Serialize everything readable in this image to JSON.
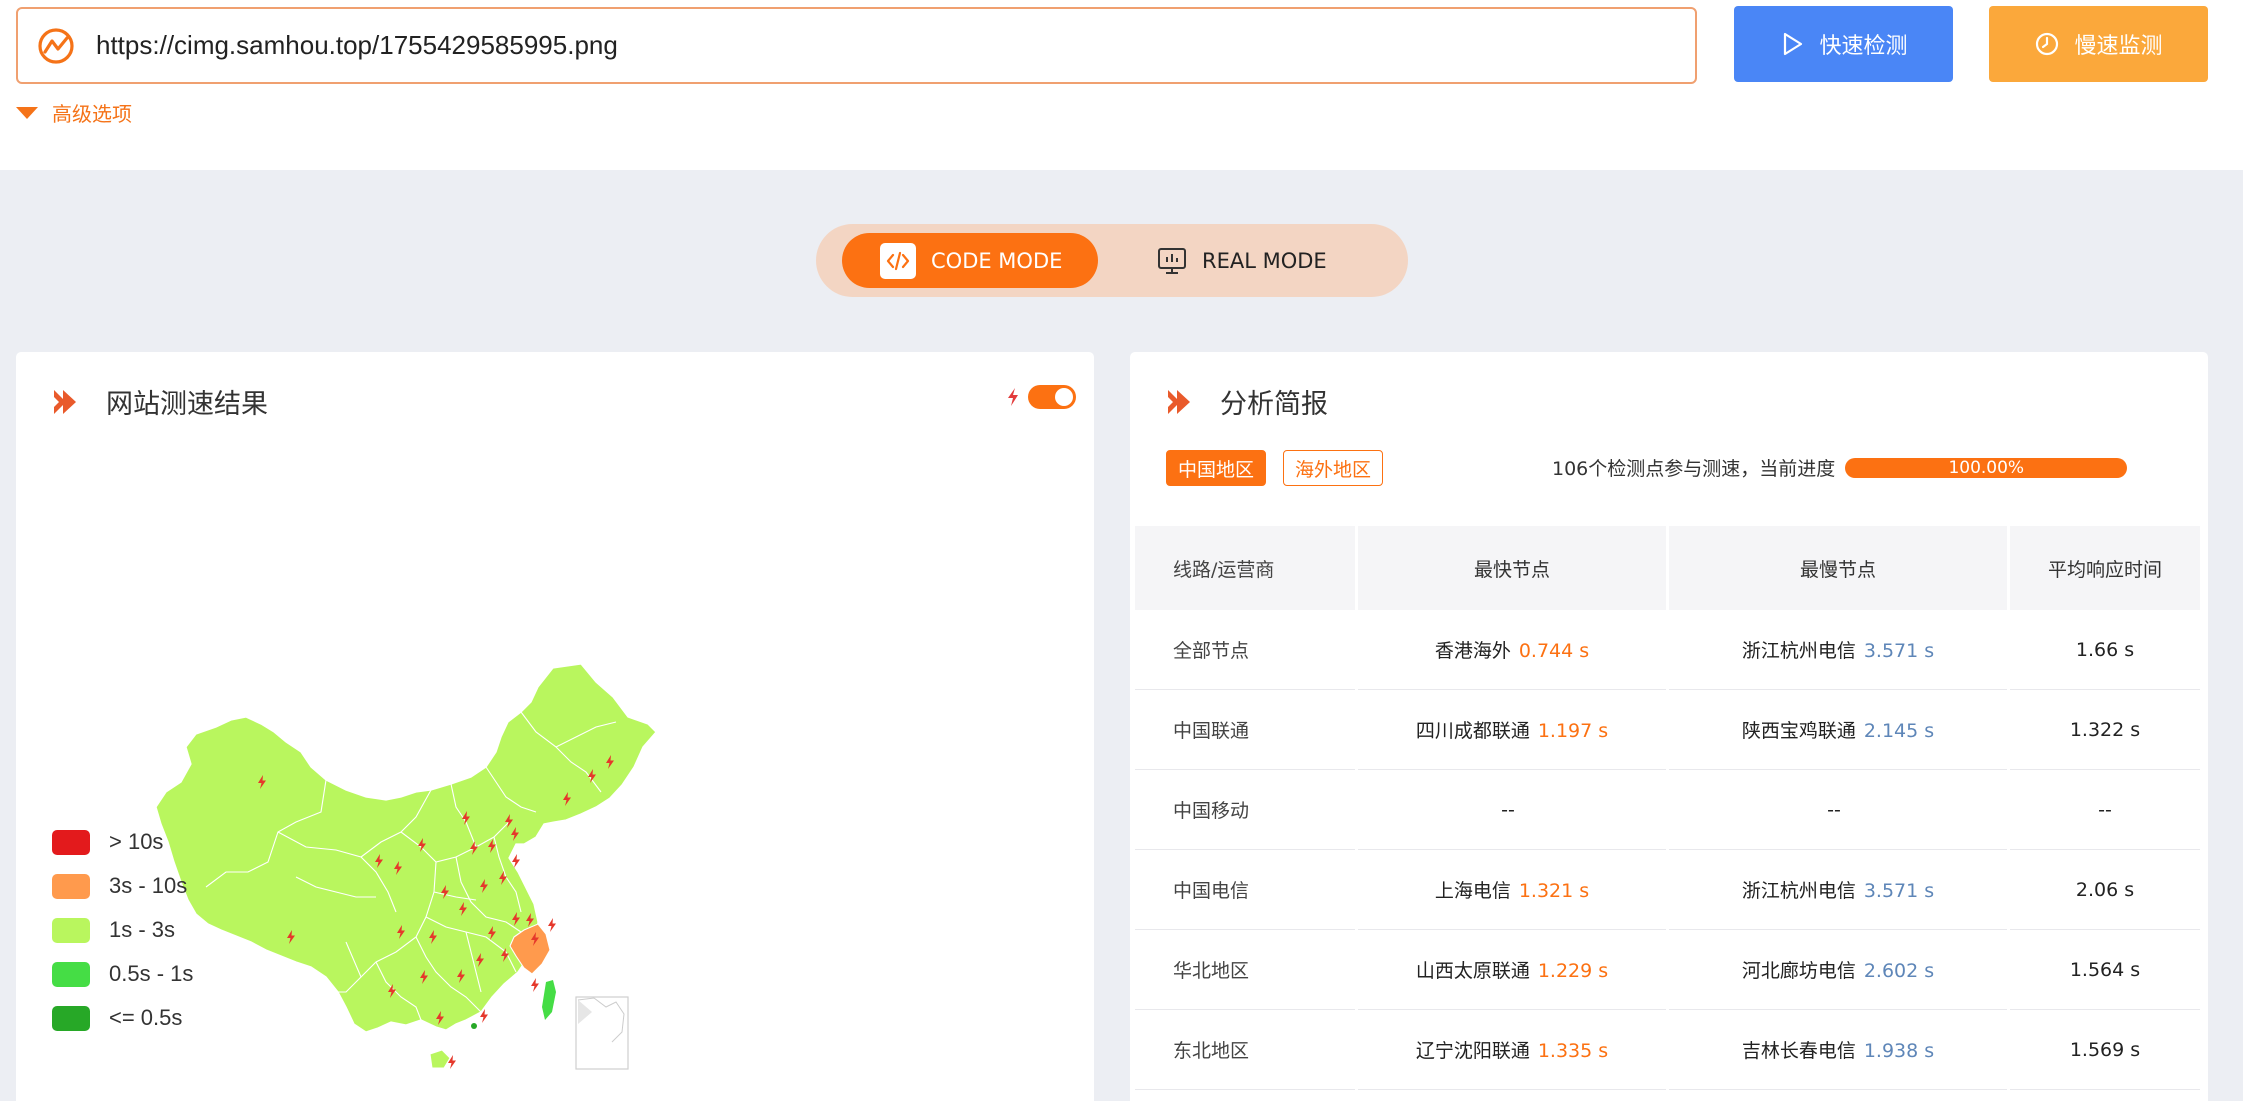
{
  "url_input": {
    "value": "https://cimg.samhou.top/1755429585995.png"
  },
  "buttons": {
    "fast": "快速检测",
    "slow": "慢速监测"
  },
  "advanced": "高级选项",
  "modes": {
    "code": "CODE MODE",
    "real": "REAL MODE",
    "active": "code"
  },
  "left_panel": {
    "title": "网站测速结果",
    "legend": [
      {
        "label": "> 10s",
        "color": "#e31a1c"
      },
      {
        "label": "3s - 10s",
        "color": "#ff9a4d"
      },
      {
        "label": "1s - 3s",
        "color": "#b9f65e"
      },
      {
        "label": "0.5s - 1s",
        "color": "#45dd45"
      },
      {
        "label": "<= 0.5s",
        "color": "#27a827"
      }
    ]
  },
  "right_panel": {
    "title": "分析简报",
    "tabs": [
      "中国地区",
      "海外地区"
    ],
    "progress_text": "106个检测点参与测速，当前进度",
    "progress_value": "100.00%",
    "table": {
      "headers": [
        "线路/运营商",
        "最快节点",
        "最慢节点",
        "平均响应时间"
      ],
      "rows": [
        {
          "line": "全部节点",
          "fast_node": "香港海外",
          "fast_time": "0.744 s",
          "slow_node": "浙江杭州电信",
          "slow_time": "3.571 s",
          "avg": "1.66 s"
        },
        {
          "line": "中国联通",
          "fast_node": "四川成都联通",
          "fast_time": "1.197 s",
          "slow_node": "陕西宝鸡联通",
          "slow_time": "2.145 s",
          "avg": "1.322 s"
        },
        {
          "line": "中国移动",
          "fast_node": "--",
          "fast_time": "",
          "slow_node": "--",
          "slow_time": "",
          "avg": "--"
        },
        {
          "line": "中国电信",
          "fast_node": "上海电信",
          "fast_time": "1.321 s",
          "slow_node": "浙江杭州电信",
          "slow_time": "3.571 s",
          "avg": "2.06 s"
        },
        {
          "line": "华北地区",
          "fast_node": "山西太原联通",
          "fast_time": "1.229 s",
          "slow_node": "河北廊坊电信",
          "slow_time": "2.602 s",
          "avg": "1.564 s"
        },
        {
          "line": "东北地区",
          "fast_node": "辽宁沈阳联通",
          "fast_time": "1.335 s",
          "slow_node": "吉林长春电信",
          "slow_time": "1.938 s",
          "avg": "1.569 s"
        }
      ]
    }
  },
  "colors": {
    "accent": "#fc7112",
    "blue": "#4a86f6",
    "amber": "#fba83b"
  }
}
